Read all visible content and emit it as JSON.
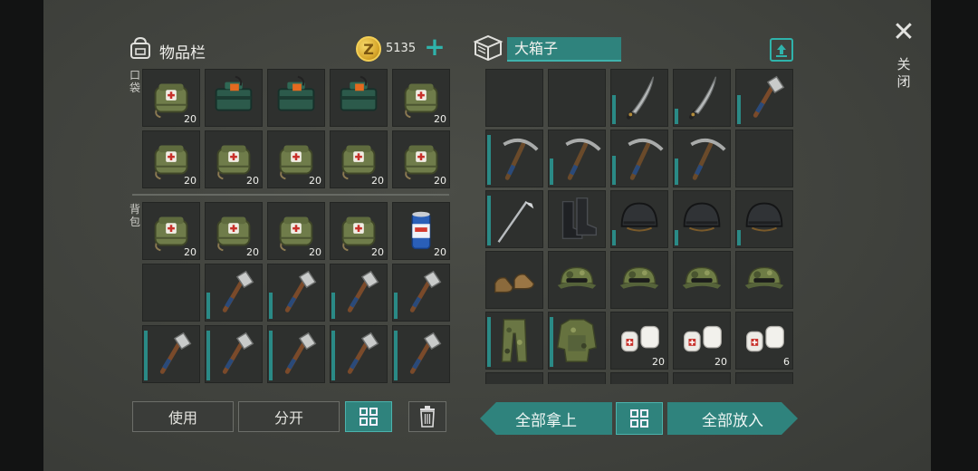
{
  "inventory": {
    "title": "物品栏",
    "coin_symbol": "Z",
    "coins": "5135",
    "pocket_label": "口袋",
    "backpack_label": "背包",
    "pocket_slots": [
      {
        "item": "medkit-bag",
        "qty": "20"
      },
      {
        "item": "toolbox",
        "qty": ""
      },
      {
        "item": "toolbox",
        "qty": ""
      },
      {
        "item": "toolbox",
        "qty": ""
      },
      {
        "item": "medkit-bag",
        "qty": "20"
      },
      {
        "item": "medkit-bag",
        "qty": "20"
      },
      {
        "item": "medkit-bag",
        "qty": "20"
      },
      {
        "item": "medkit-bag",
        "qty": "20"
      },
      {
        "item": "medkit-bag",
        "qty": "20"
      },
      {
        "item": "medkit-bag",
        "qty": "20"
      }
    ],
    "backpack_slots": [
      {
        "item": "medkit-bag",
        "qty": "20"
      },
      {
        "item": "medkit-bag",
        "qty": "20"
      },
      {
        "item": "medkit-bag",
        "qty": "20"
      },
      {
        "item": "medkit-bag",
        "qty": "20"
      },
      {
        "item": "soda-can",
        "qty": "20"
      },
      {
        "item": "empty",
        "qty": ""
      },
      {
        "item": "hatchet",
        "qty": "",
        "durability": 0.5
      },
      {
        "item": "hatchet",
        "qty": "",
        "durability": 0.5
      },
      {
        "item": "hatchet",
        "qty": "",
        "durability": 0.5
      },
      {
        "item": "hatchet",
        "qty": "",
        "durability": 0.5
      },
      {
        "item": "hatchet",
        "qty": "",
        "durability": 0.95
      },
      {
        "item": "hatchet",
        "qty": "",
        "durability": 0.95
      },
      {
        "item": "hatchet",
        "qty": "",
        "durability": 0.95
      },
      {
        "item": "hatchet",
        "qty": "",
        "durability": 0.95
      },
      {
        "item": "hatchet",
        "qty": "",
        "durability": 0.95
      }
    ]
  },
  "box": {
    "title": "大箱子",
    "slots": [
      {
        "item": "empty",
        "qty": ""
      },
      {
        "item": "empty",
        "qty": ""
      },
      {
        "item": "machete",
        "qty": "",
        "durability": 0.55
      },
      {
        "item": "machete",
        "qty": "",
        "durability": 0.3
      },
      {
        "item": "hatchet",
        "qty": "",
        "durability": 0.55
      },
      {
        "item": "pickaxe",
        "qty": "",
        "durability": 0.95
      },
      {
        "item": "pickaxe",
        "qty": "",
        "durability": 0.5
      },
      {
        "item": "pickaxe",
        "qty": "",
        "durability": 0.55
      },
      {
        "item": "pickaxe",
        "qty": "",
        "durability": 0.5
      },
      {
        "item": "empty",
        "qty": ""
      },
      {
        "item": "golf-club",
        "qty": "",
        "durability": 0.95
      },
      {
        "item": "combat-boots",
        "qty": ""
      },
      {
        "item": "helmet",
        "qty": "",
        "durability": 0.3
      },
      {
        "item": "helmet",
        "qty": "",
        "durability": 0.3
      },
      {
        "item": "helmet",
        "qty": "",
        "durability": 0.3
      },
      {
        "item": "work-boots",
        "qty": ""
      },
      {
        "item": "camo-cap",
        "qty": ""
      },
      {
        "item": "camo-cap",
        "qty": ""
      },
      {
        "item": "camo-cap",
        "qty": ""
      },
      {
        "item": "camo-cap",
        "qty": ""
      },
      {
        "item": "camo-pants",
        "qty": "",
        "durability": 0.95
      },
      {
        "item": "camo-vest",
        "qty": "",
        "durability": 0.95
      },
      {
        "item": "bandage",
        "qty": "20"
      },
      {
        "item": "bandage",
        "qty": "20"
      },
      {
        "item": "bandage",
        "qty": "6"
      },
      {
        "item": "empty",
        "qty": ""
      },
      {
        "item": "empty",
        "qty": ""
      },
      {
        "item": "empty",
        "qty": ""
      },
      {
        "item": "empty",
        "qty": ""
      },
      {
        "item": "empty",
        "qty": ""
      }
    ]
  },
  "buttons": {
    "use": "使用",
    "split": "分开",
    "take_all": "全部拿上",
    "put_all": "全部放入",
    "close_glyph": "✕",
    "close_label": "关闭"
  },
  "colors": {
    "accent": "#2f837d",
    "durability_bar": "#2a8a86",
    "coin": "#e1b53c"
  }
}
